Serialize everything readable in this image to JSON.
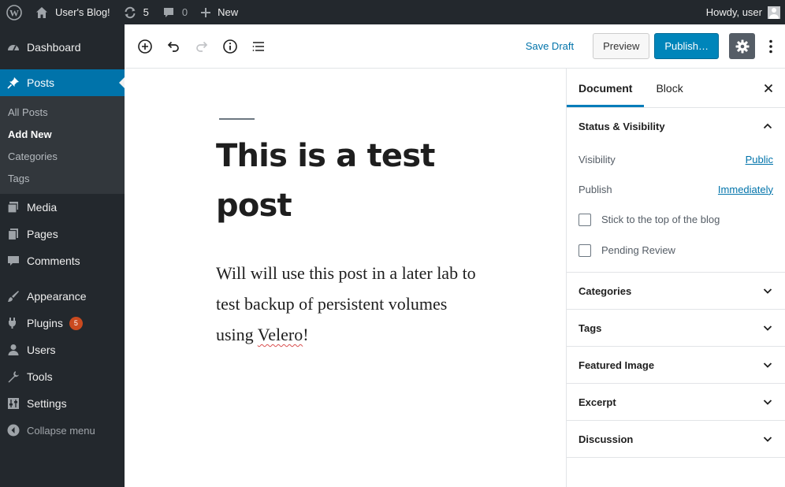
{
  "adminbar": {
    "wp_logo_icon": "wordpress-logo-icon",
    "site_name": "User's Blog!",
    "updates_count": "5",
    "comments_count": "0",
    "new_label": "New",
    "howdy": "Howdy, user"
  },
  "sidebar": {
    "dashboard": "Dashboard",
    "posts": "Posts",
    "submenu": [
      "All Posts",
      "Add New",
      "Categories",
      "Tags"
    ],
    "media": "Media",
    "pages": "Pages",
    "comments": "Comments",
    "appearance": "Appearance",
    "plugins": "Plugins",
    "plugins_badge": "5",
    "users": "Users",
    "tools": "Tools",
    "settings": "Settings",
    "collapse": "Collapse menu"
  },
  "toolbar": {
    "save_draft": "Save Draft",
    "preview": "Preview",
    "publish": "Publish…"
  },
  "post": {
    "title": "This is a test post",
    "body_before": "Will will use this post in a later lab to test backup of persistent volumes using ",
    "body_misspelled": "Velero",
    "body_after": "!"
  },
  "panel": {
    "tabs": [
      "Document",
      "Block"
    ],
    "status_visibility": "Status & Visibility",
    "visibility_label": "Visibility",
    "visibility_value": "Public",
    "publish_label": "Publish",
    "publish_value": "Immediately",
    "stick_label": "Stick to the top of the blog",
    "pending_label": "Pending Review",
    "sections": [
      "Categories",
      "Tags",
      "Featured Image",
      "Excerpt",
      "Discussion"
    ]
  },
  "colors": {
    "admin_dark": "#23282d",
    "accent_blue": "#0073aa",
    "publish_blue": "#0085ba",
    "badge_orange": "#ca4a1f"
  }
}
